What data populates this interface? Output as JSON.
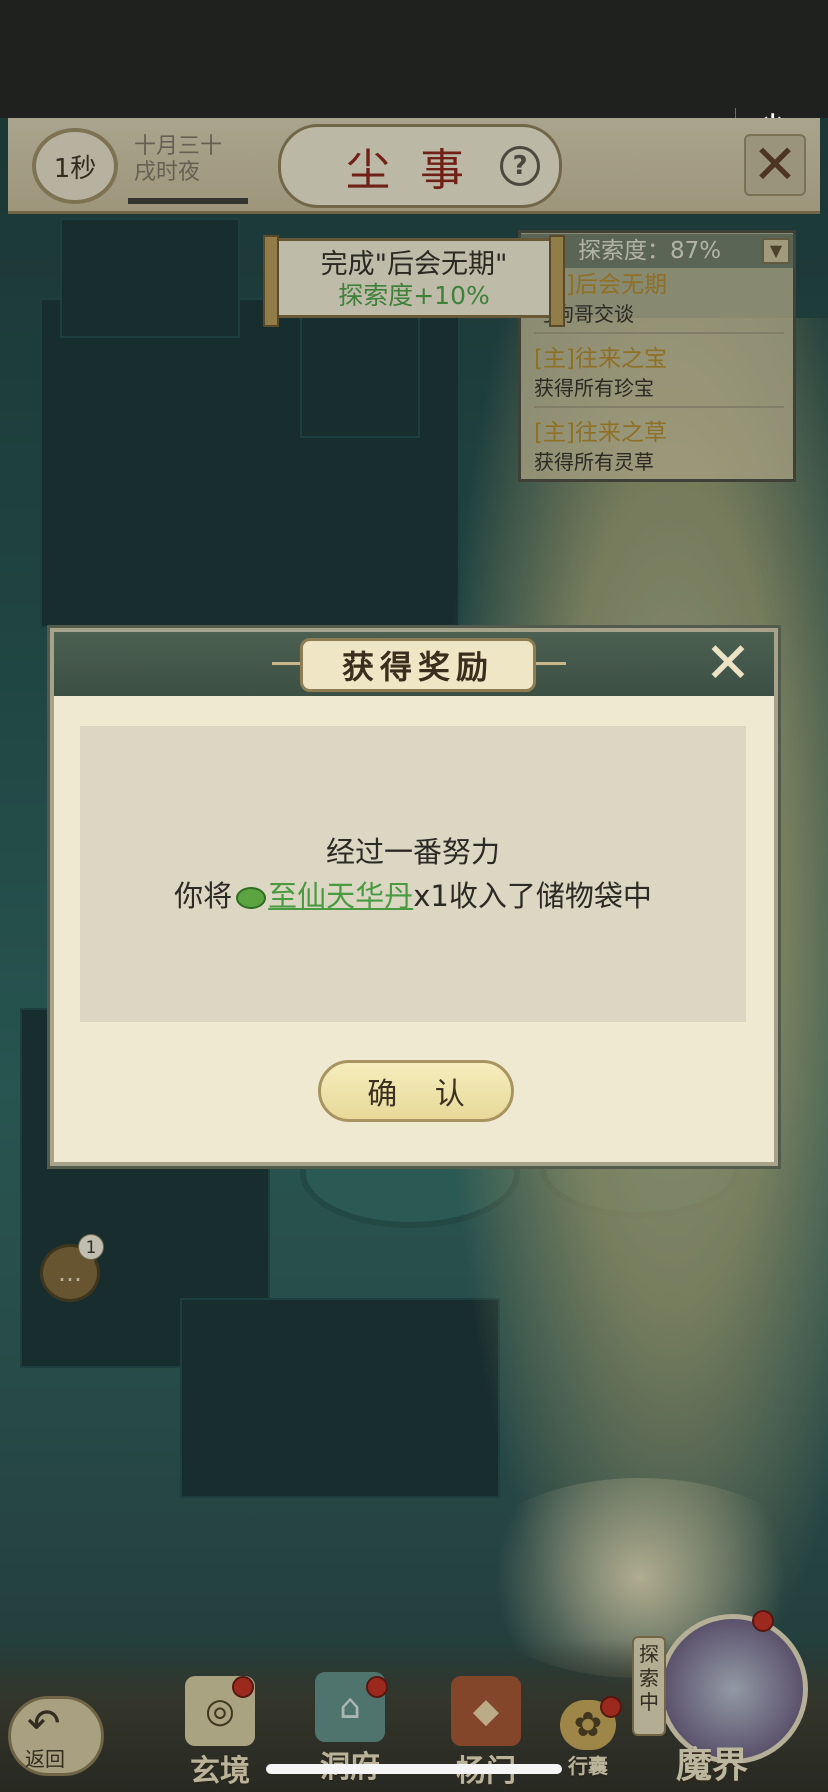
{
  "capsule": {
    "more_icon": "•••",
    "power_icon": "⏻"
  },
  "header": {
    "timer": "1秒",
    "date_line1": "十月三十",
    "date_line2": "戌时夜",
    "title": "尘事",
    "help_icon": "?",
    "close_icon": "✕"
  },
  "toast": {
    "line1": "完成\"后会无期\"",
    "line2": "探索度+10%"
  },
  "quests": {
    "progress": "探索度：87%",
    "items": [
      {
        "title": "[主]后会无期",
        "desc": "与狗哥交谈"
      },
      {
        "title": "[主]往来之宝",
        "desc": "获得所有珍宝"
      },
      {
        "title": "[主]往来之草",
        "desc": "获得所有灵草"
      }
    ]
  },
  "modal": {
    "title": "获得奖励",
    "close_icon": "✕",
    "message_line1": "经过一番努力",
    "message_prefix": "你将",
    "item_name": "至仙天华丹",
    "item_count": "x1",
    "message_suffix": "收入了储物袋中",
    "confirm": "确 认"
  },
  "chat": {
    "badge": "1",
    "icon": "…"
  },
  "bottom_nav": {
    "back": "返回",
    "items": [
      "玄境",
      "洞府",
      "杨门",
      "行囊"
    ],
    "explore_tag": "探索中",
    "realm": "魔界"
  }
}
